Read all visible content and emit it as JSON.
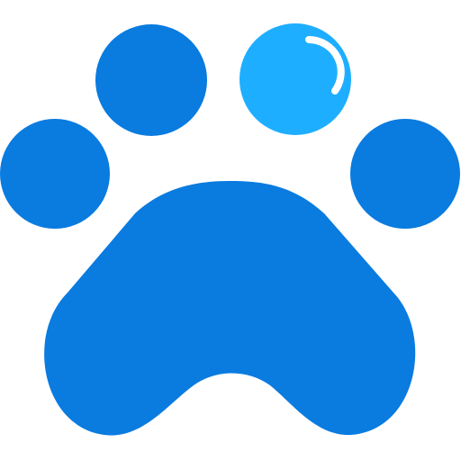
{
  "icon": {
    "name": "paw-icon",
    "colors": {
      "primary": "#0A7BDF",
      "highlight_toe": "#1EAEFF",
      "shine": "#FFFFFF"
    },
    "parts": {
      "toes": [
        "toe-left-top",
        "toe-right-top-highlighted",
        "toe-left",
        "toe-right"
      ],
      "pad": "main-pad"
    }
  }
}
